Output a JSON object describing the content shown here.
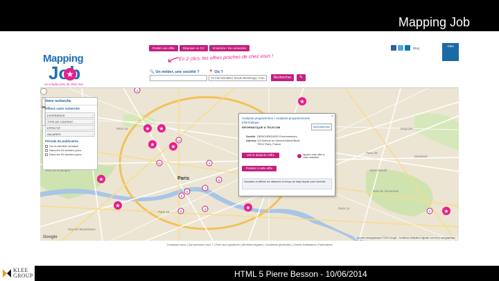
{
  "slide": {
    "title": "Mapping Job",
    "footer": "HTML 5 Pierre Besson -  10/06/2014",
    "company_logo": "KLEE GROUP"
  },
  "site": {
    "nav": [
      "Poster une offre",
      "Déposer un CV",
      "S'inscrire / Se connecter"
    ],
    "blog_label": "Blog",
    "bookmark_label": "Jobs",
    "logo_line1": "Mapping",
    "logo_line2": "Job",
    "logo_tagline": "Un emploi près de chez moi",
    "slogan": "En 2 clics, les offres proches de chez vous !",
    "search": {
      "job_label": "Un métier, une société ?",
      "location_label": "Où ?",
      "location_value": "78 Cité Mondétel, 92120 Montrouge, Fran",
      "search_button": "Rechercher",
      "tool_icon": "wrench-icon"
    },
    "sidebar": {
      "title": "Votre recherche",
      "refine_title": "Affinez votre recherche",
      "filters": [
        "EXPERIENCE",
        "TYPE DE CONTRAT",
        "EFFECTIF",
        "SALAIRES"
      ],
      "period_title": "Période de publication",
      "periods": [
        "Sur la dernière semaine",
        "Dans les 15 derniers jours",
        "Dans les 30 derniers jours"
      ]
    },
    "popup": {
      "title": "Analyste programmeur / Analyste-programmeuse informatique",
      "category": "INFORMATIQUE & TELECOM",
      "company_label": "Société",
      "company": "DERICHEBOURG Environnement",
      "address_label": "Adresse",
      "address_line1": "119 Avenue du Général Michel Bizot,",
      "address_line2": "75012 Paris, France",
      "logo_text": "DERICHEBOURG",
      "detail_button": "Voir le détail de l'offre",
      "apply_button": "Postuler à cette offre",
      "favorite_text": "Ajouter cette offre à votre sélection",
      "info": "Visualiser et afficher les distances et temps de trajet depuis votre domicile"
    },
    "map": {
      "city_label": "Paris",
      "streets": [
        "Boulevard Périphérique",
        "Paris 14",
        "Paris 15",
        "Paris 12",
        "Paris 16",
        "Paris 10",
        "Paris 11",
        "Paris 20",
        "Bois de Boulogne",
        "Bois de Vincennes",
        "Saint-Mandé",
        "Montreuil",
        "Issy-les-Moulineaux",
        "Bagnolet"
      ],
      "credit": "Données cartographiques ©2013 Google - Conditions d'utilisation   Signaler une erreur cartographique",
      "google": "Google",
      "pin_numbers": [
        "3",
        "4",
        "5",
        "7",
        "11",
        "14",
        "6",
        "2",
        "3",
        "5",
        "2"
      ]
    },
    "footer_links": "Contactez-nous  |  Qui sommes-nous ?  |  Foire aux questions  |  Mentions légales  |  Conditions générales  |  Charte d'utilisation  |  Partenaires"
  },
  "colors": {
    "brand_blue": "#1e6fb8",
    "brand_pink": "#c2207f",
    "map_bg": "#ece5d3"
  }
}
